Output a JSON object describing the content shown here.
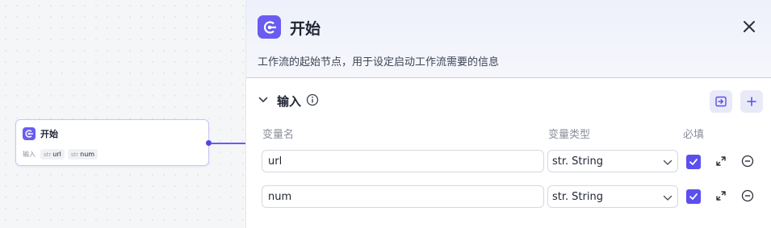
{
  "node": {
    "title": "开始",
    "input_label": "输入",
    "vars": [
      {
        "type": "str",
        "name": "url"
      },
      {
        "type": "str",
        "name": "num"
      }
    ]
  },
  "panel": {
    "title": "开始",
    "description": "工作流的起始节点，用于设定启动工作流需要的信息",
    "section_title": "输入",
    "columns": {
      "name": "变量名",
      "type": "变量类型",
      "required": "必填"
    },
    "rows": [
      {
        "name": "url",
        "type_prefix": "str.",
        "type": "String",
        "required": true
      },
      {
        "name": "num",
        "type_prefix": "str.",
        "type": "String",
        "required": true
      }
    ]
  },
  "icons": {
    "node_icon": "start-icon",
    "close": "close-icon",
    "collapse": "chevron-down-icon",
    "info": "info-icon",
    "import": "import-icon",
    "add": "plus-icon",
    "expand": "expand-icon",
    "remove": "minus-circle-icon"
  },
  "colors": {
    "accent": "#6a5cf0",
    "checkbox": "#5b4ff0"
  }
}
